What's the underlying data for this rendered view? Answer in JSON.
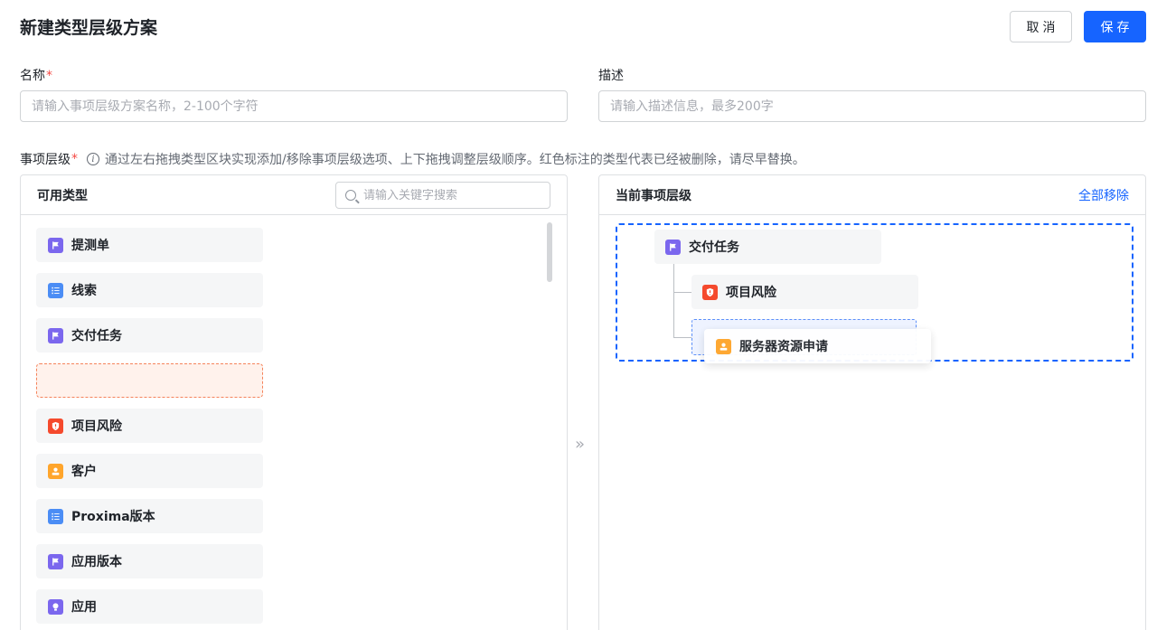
{
  "header": {
    "title": "新建类型层级方案",
    "cancel_label": "取消",
    "save_label": "保存"
  },
  "form": {
    "name_label": "名称",
    "name_placeholder": "请输入事项层级方案名称，2-100个字符",
    "desc_label": "描述",
    "desc_placeholder": "请输入描述信息，最多200字",
    "required_mark": "*"
  },
  "hierarchy": {
    "label": "事项层级",
    "info_icon": "i",
    "hint": "通过左右拖拽类型区块实现添加/移除事项层级选项、上下拖拽调整层级顺序。红色标注的类型代表已经被删除，请尽早替换。"
  },
  "available": {
    "title": "可用类型",
    "search_placeholder": "请输入关键字搜索",
    "items": [
      {
        "label": "提测单",
        "icon": "flag-icon",
        "color": "#7b67ee"
      },
      {
        "label": "线索",
        "icon": "list-icon",
        "color": "#4b8df5"
      },
      {
        "label": "交付任务",
        "icon": "flag-icon",
        "color": "#7b67ee"
      },
      {
        "label": "",
        "icon": "",
        "color": ""
      },
      {
        "label": "项目风险",
        "icon": "shield-icon",
        "color": "#f54a2d"
      },
      {
        "label": "客户",
        "icon": "user-icon",
        "color": "#ffa52b"
      },
      {
        "label": "Proxima版本",
        "icon": "list-icon",
        "color": "#4b8df5"
      },
      {
        "label": "应用版本",
        "icon": "flag-icon",
        "color": "#7b67ee"
      },
      {
        "label": "应用",
        "icon": "bulb-icon",
        "color": "#7b67ee"
      }
    ]
  },
  "move_arrow": "»",
  "current": {
    "title": "当前事项层级",
    "remove_all_label": "全部移除",
    "root": {
      "label": "交付任务",
      "icon": "flag-icon"
    },
    "child": {
      "label": "项目风险",
      "icon": "shield-icon"
    },
    "dragging": {
      "label": "服务器资源申请",
      "icon": "user-icon"
    }
  }
}
